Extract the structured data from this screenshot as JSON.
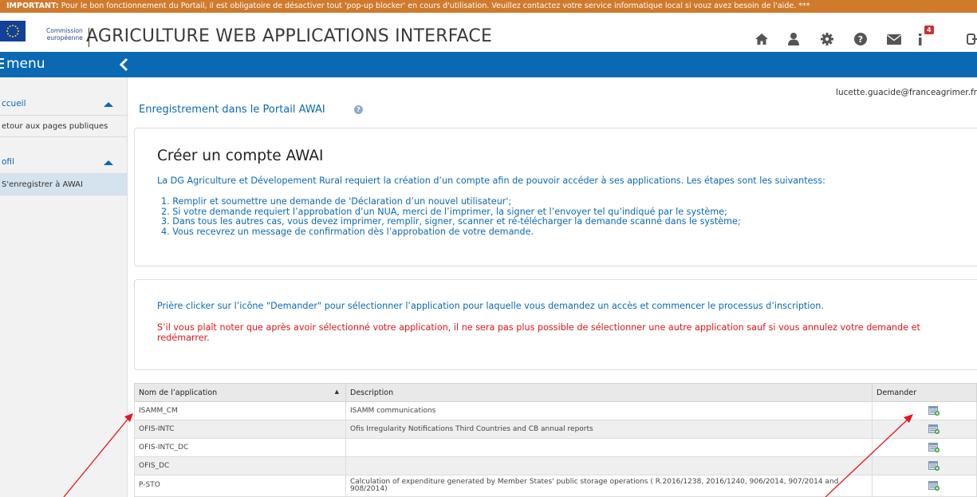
{
  "banner": {
    "prefix": "IMPORTANT:",
    "text": " Pour le bon fonctionnement du Portail, il est obligatoire de désactiver tout 'pop-up blocker' en cours d'utilisation. Veuillez contactez votre service informatique local si vouz avez besoin de l'aide. ***"
  },
  "header": {
    "commission_line1": "Commission",
    "commission_line2": "européenne",
    "title": "AGRICULTURE WEB APPLICATIONS INTERFACE",
    "notification_count": "4",
    "icons": [
      "home-icon",
      "user-icon",
      "gear-icon",
      "help-icon",
      "mail-icon",
      "info-icon",
      "logout-icon"
    ]
  },
  "menu": {
    "label": "menu"
  },
  "sidebar": {
    "sections": [
      {
        "label": "ccueil",
        "items": [
          "etour aux pages publiques"
        ]
      },
      {
        "label": "ofil",
        "items": [
          "S'enregistrer à AWAI"
        ]
      }
    ]
  },
  "user": {
    "email": "lucette.guacide@franceagrimer.fr"
  },
  "page": {
    "title": "Enregistrement dans le Portail AWAI"
  },
  "create": {
    "title": "Créer un compte AWAI",
    "intro": "La DG Agriculture et Dévelopement Rural requiert la création d’un compte afin de pouvoir accéder à ses applications. Les étapes sont les suivantess:",
    "steps": [
      "1. Remplir et soumettre une demande de 'Déclaration d’un nouvel utilisateur';",
      "2. Si votre demande requiert l’approbation d’un NUA, merci de l’imprimer, la signer et l’envoyer tel qu’indiqué par le système;",
      "3. Dans tous les autres cas, vous devez imprimer, remplir, signer, scanner et ré-télécharger la demande scanné dans le système;",
      "4. Vous recevrez un message de confirmation dès l’approbation de votre demande."
    ]
  },
  "notice": {
    "prompt": "Prière clicker sur l’icône \"Demander\" pour sélectionner l’application pour laquelle vous demandez un accès et commencer le processus d’inscription.",
    "warning": "S’il vous plaît noter que après avoir sélectionné votre application, il ne sera pas plus possible de sélectionner une autre application sauf si vous annulez votre demande et redémarrer."
  },
  "table": {
    "columns": [
      "Nom de l’application",
      "Description",
      "Demander"
    ],
    "rows": [
      {
        "name": "ISAMM_CM",
        "description": "ISAMM communications"
      },
      {
        "name": "OFIS-INTC",
        "description": "Ofis Irregularity Notifications Third Countries and CB annual reports"
      },
      {
        "name": "OFIS-INTC_DC",
        "description": ""
      },
      {
        "name": "OFIS_DC",
        "description": ""
      },
      {
        "name": "P-STO",
        "description": "Calculation of expenditure generated by Member States' public storage operations ( R.2016/1238, 2016/1240, 906/2014, 907/2014 and 908/2014)"
      }
    ]
  },
  "colors": {
    "banner": "#d07a2c",
    "menubar": "#0b69b3",
    "link_blue": "#0b69b3",
    "warning_red": "#e0161c",
    "annotation_arrow": "#e8141b"
  }
}
